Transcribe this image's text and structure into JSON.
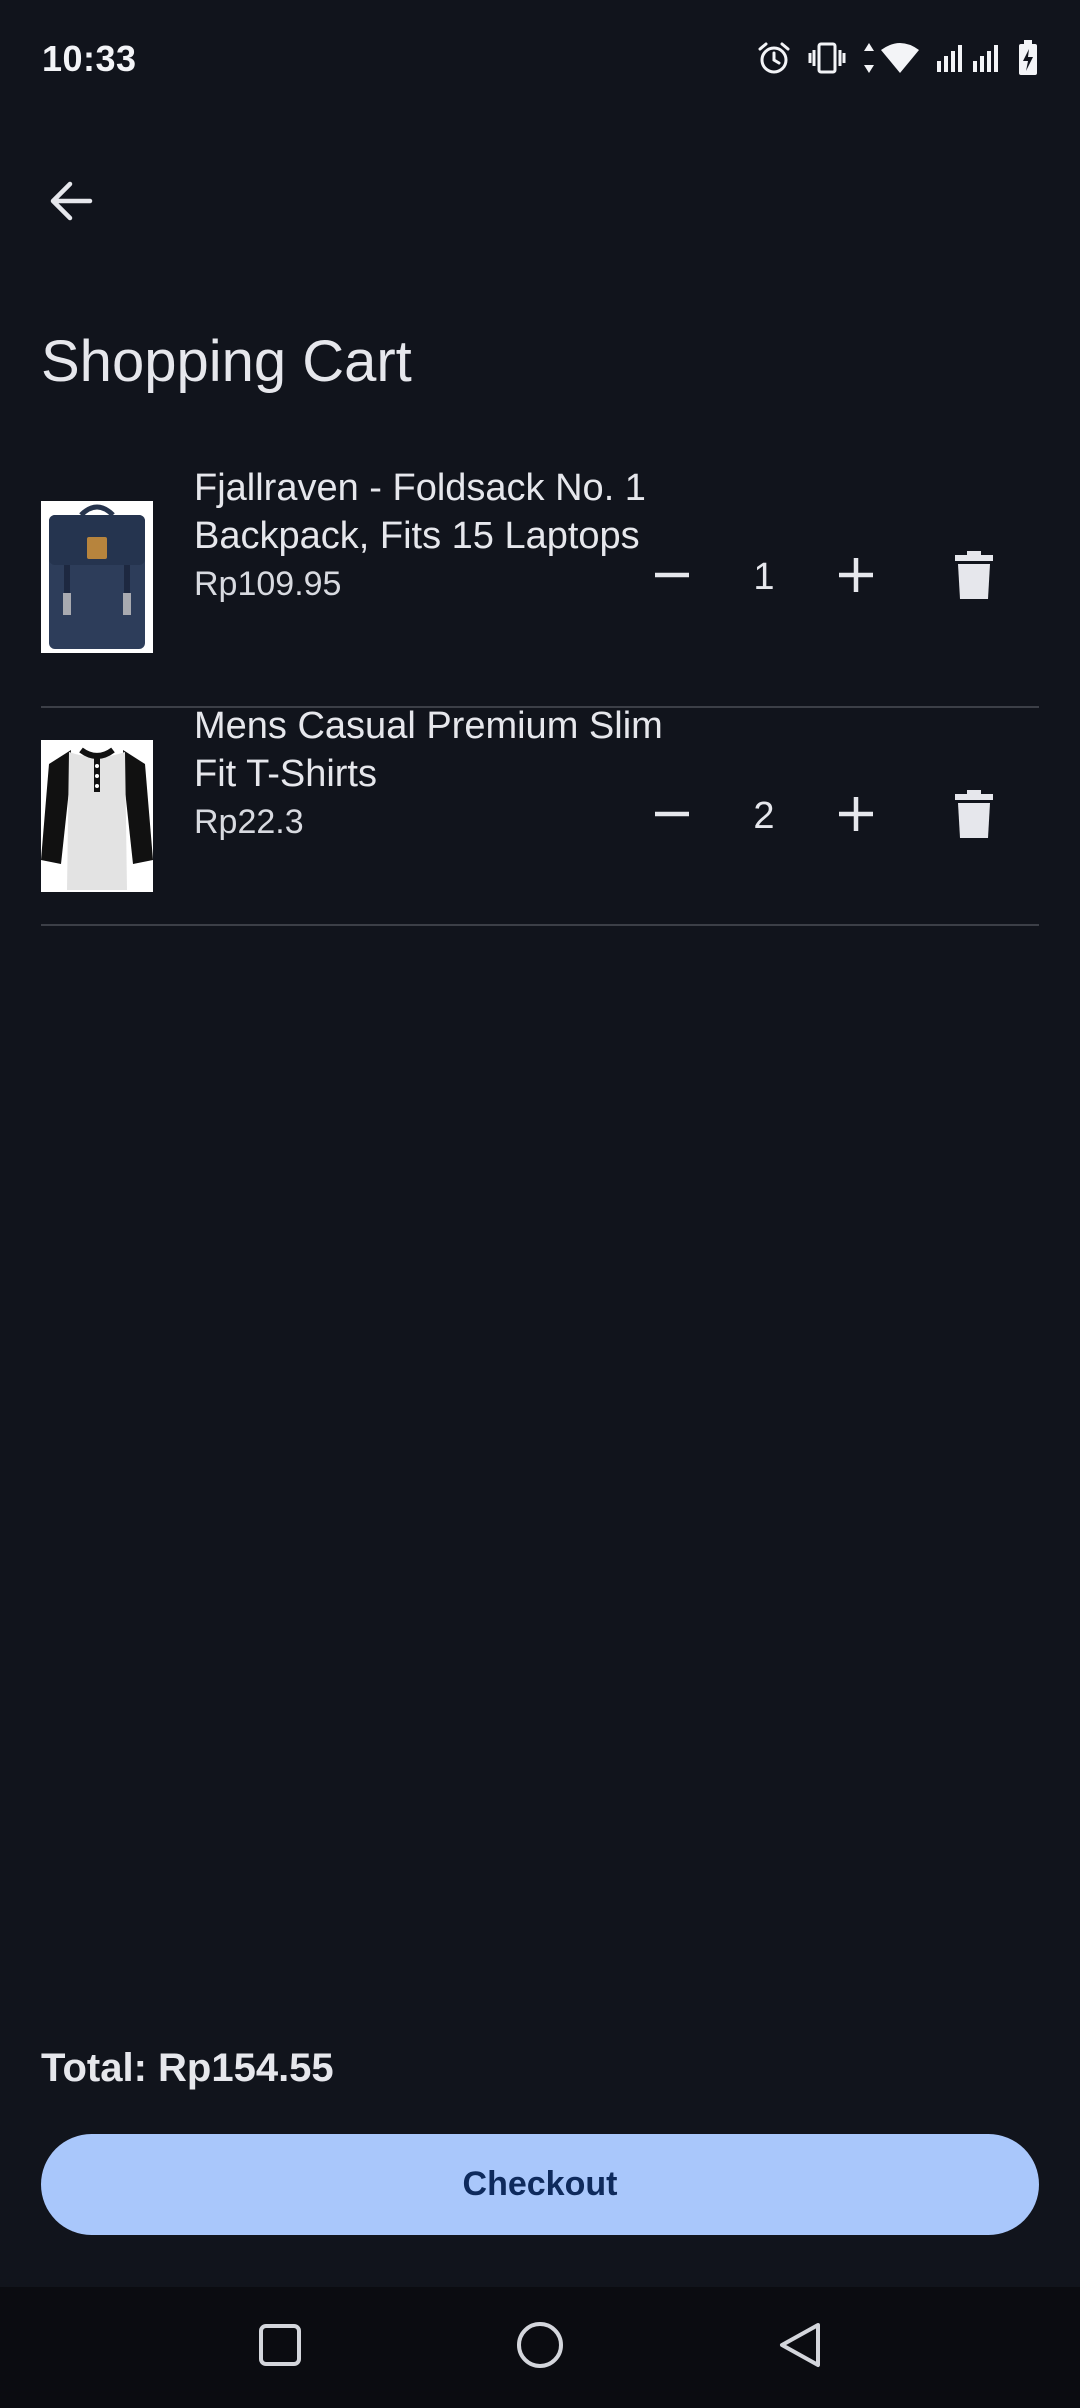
{
  "status_bar": {
    "time": "10:33",
    "icons": [
      "alarm-icon",
      "vibrate-icon",
      "data-arrows-icon",
      "wifi-icon",
      "signal-icon",
      "signal-icon",
      "battery-charging-icon"
    ]
  },
  "header": {
    "back_icon": "arrow-left-icon",
    "title": "Shopping Cart"
  },
  "cart": {
    "items": [
      {
        "name": "Fjallraven - Foldsack No. 1 Backpack, Fits 15 Laptops",
        "price": "Rp109.95",
        "quantity": "1",
        "image": "backpack"
      },
      {
        "name": "Mens Casual Premium Slim Fit T-Shirts",
        "price": "Rp22.3",
        "quantity": "2",
        "image": "henley-shirt"
      }
    ]
  },
  "footer": {
    "total": "Total: Rp154.55",
    "checkout_label": "Checkout"
  },
  "navigation": {
    "buttons": [
      "recents-square-icon",
      "home-circle-icon",
      "back-triangle-icon"
    ]
  },
  "colors": {
    "background": "#11141c",
    "text": "#e6e7ec",
    "divider": "#3c3f47",
    "accent": "#a9c7fb",
    "accent_text": "#0e2a5c",
    "nav_bar": "#0b0c11"
  }
}
